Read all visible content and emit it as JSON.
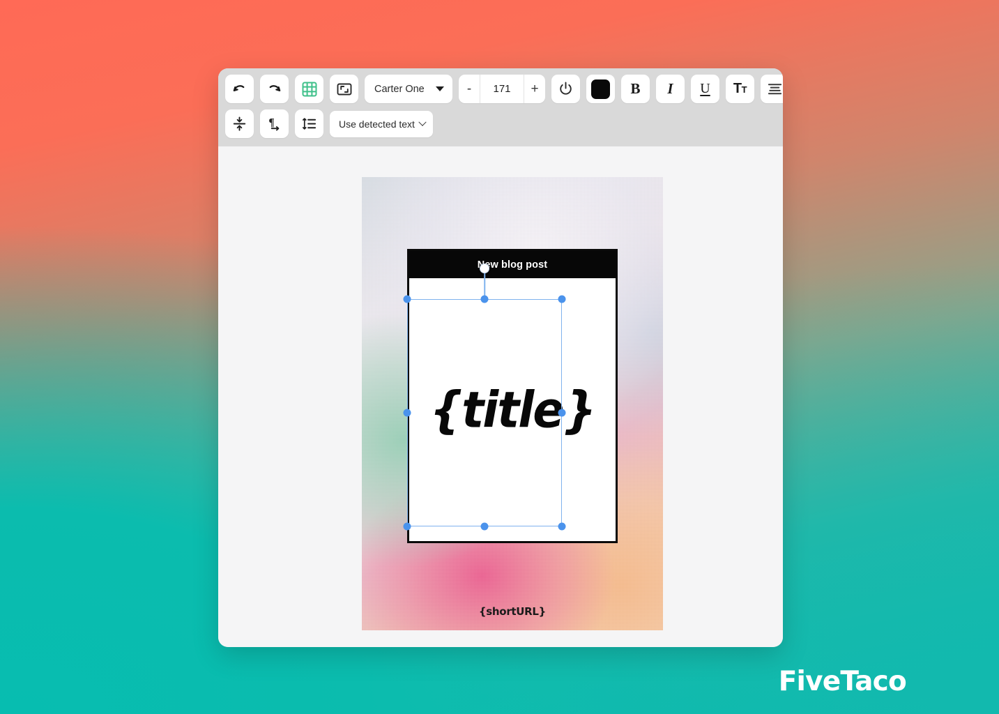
{
  "toolbar": {
    "row1": [
      {
        "name": "undo-button",
        "icon": "undo-icon",
        "label": "Undo"
      },
      {
        "name": "redo-button",
        "icon": "redo-icon",
        "label": "Redo"
      },
      {
        "name": "grid-toggle-button",
        "icon": "grid-icon",
        "label": "Grid",
        "active": true,
        "accent": "#3fc08a"
      },
      {
        "name": "resize-button",
        "icon": "resize-icon",
        "label": "Resize"
      }
    ],
    "font_family": {
      "name": "font-family-select",
      "value": "Carter One"
    },
    "font_size": {
      "name": "font-size-stepper",
      "decrease_label": "-",
      "value": "171",
      "increase_label": "+"
    },
    "row1_after": [
      {
        "name": "power-button",
        "icon": "power-icon",
        "label": "Power"
      },
      {
        "name": "text-color-button",
        "icon": "color-swatch-icon",
        "label": "Text color",
        "color": "#090909"
      },
      {
        "name": "bold-button",
        "icon": "bold-icon",
        "label": "B"
      },
      {
        "name": "italic-button",
        "icon": "italic-icon",
        "label": "I"
      },
      {
        "name": "underline-button",
        "icon": "underline-icon",
        "label": "U"
      },
      {
        "name": "text-size-button",
        "icon": "text-size-icon",
        "label": "T",
        "label_small": "T"
      },
      {
        "name": "align-center-button",
        "icon": "align-center-icon",
        "label": "Align center"
      }
    ],
    "row2": [
      {
        "name": "vertical-align-button",
        "icon": "vertical-align-icon",
        "label": "Vertical align"
      },
      {
        "name": "text-direction-button",
        "icon": "paragraph-direction-icon",
        "label": "Text direction"
      },
      {
        "name": "line-height-button",
        "icon": "line-height-icon",
        "label": "Line height"
      }
    ],
    "detected_text": {
      "name": "detected-text-select",
      "value": "Use detected text"
    }
  },
  "poster": {
    "banner_text": "New blog post",
    "title_text": "{title}",
    "short_url_text": "{shortURL}",
    "banner_bg": "#070707",
    "card_bg": "#ffffff",
    "card_border": "#0a0a0a"
  },
  "selection": {
    "name": "text-selection-box",
    "handle_color": "#4b93ec",
    "outline_color": "#7fb2ee",
    "handles": [
      "top-left",
      "top-center",
      "top-right",
      "middle-left",
      "middle-right",
      "bottom-left",
      "bottom-center",
      "bottom-right"
    ],
    "rotate_handle_label": "Rotate"
  },
  "brand": {
    "name": "FiveTaco"
  },
  "theme": {
    "backdrop_start": "#ff6a56",
    "backdrop_end": "#0bbcae",
    "toolbar_bg": "#d9d9d9",
    "canvas_bg": "#f5f5f6",
    "button_bg": "#ffffff"
  }
}
